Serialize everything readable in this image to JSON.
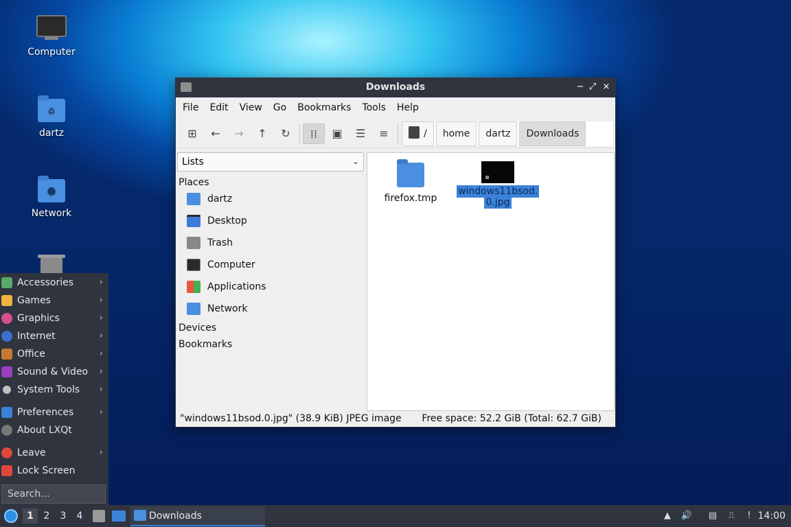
{
  "desktop": {
    "icons": [
      {
        "label": "Computer"
      },
      {
        "label": "dartz"
      },
      {
        "label": "Network"
      }
    ]
  },
  "window": {
    "title": "Downloads",
    "controls": {
      "minimize": "−",
      "restore": "⤢",
      "close": "×"
    },
    "menu": [
      "File",
      "Edit",
      "View",
      "Go",
      "Bookmarks",
      "Tools",
      "Help"
    ],
    "breadcrumbs": [
      "/",
      "home",
      "dartz",
      "Downloads"
    ],
    "side_pane": {
      "combo_value": "Lists",
      "sections": {
        "places": "Places",
        "devices": "Devices",
        "bookmarks": "Bookmarks"
      },
      "places": [
        {
          "label": "dartz"
        },
        {
          "label": "Desktop"
        },
        {
          "label": "Trash"
        },
        {
          "label": "Computer"
        },
        {
          "label": "Applications"
        },
        {
          "label": "Network"
        }
      ]
    },
    "files": [
      {
        "name": "firefox.tmp"
      },
      {
        "name_line1": "windows11bsod.",
        "name_line2": "0.jpg"
      }
    ],
    "status": {
      "left": "\"windows11bsod.0.jpg\" (38.9 KiB) JPEG image",
      "right": "Free space: 52.2 GiB (Total: 62.7 GiB)"
    }
  },
  "start_menu": {
    "items": [
      {
        "label": "Accessories"
      },
      {
        "label": "Games"
      },
      {
        "label": "Graphics"
      },
      {
        "label": "Internet"
      },
      {
        "label": "Office"
      },
      {
        "label": "Sound & Video"
      },
      {
        "label": "System Tools"
      },
      {
        "label": "Preferences"
      },
      {
        "label": "About LXQt"
      },
      {
        "label": "Leave"
      },
      {
        "label": "Lock Screen"
      }
    ],
    "search_placeholder": "Search..."
  },
  "taskbar": {
    "workspaces": [
      "1",
      "2",
      "3",
      "4"
    ],
    "task_label": "Downloads",
    "clock": "14:00"
  }
}
